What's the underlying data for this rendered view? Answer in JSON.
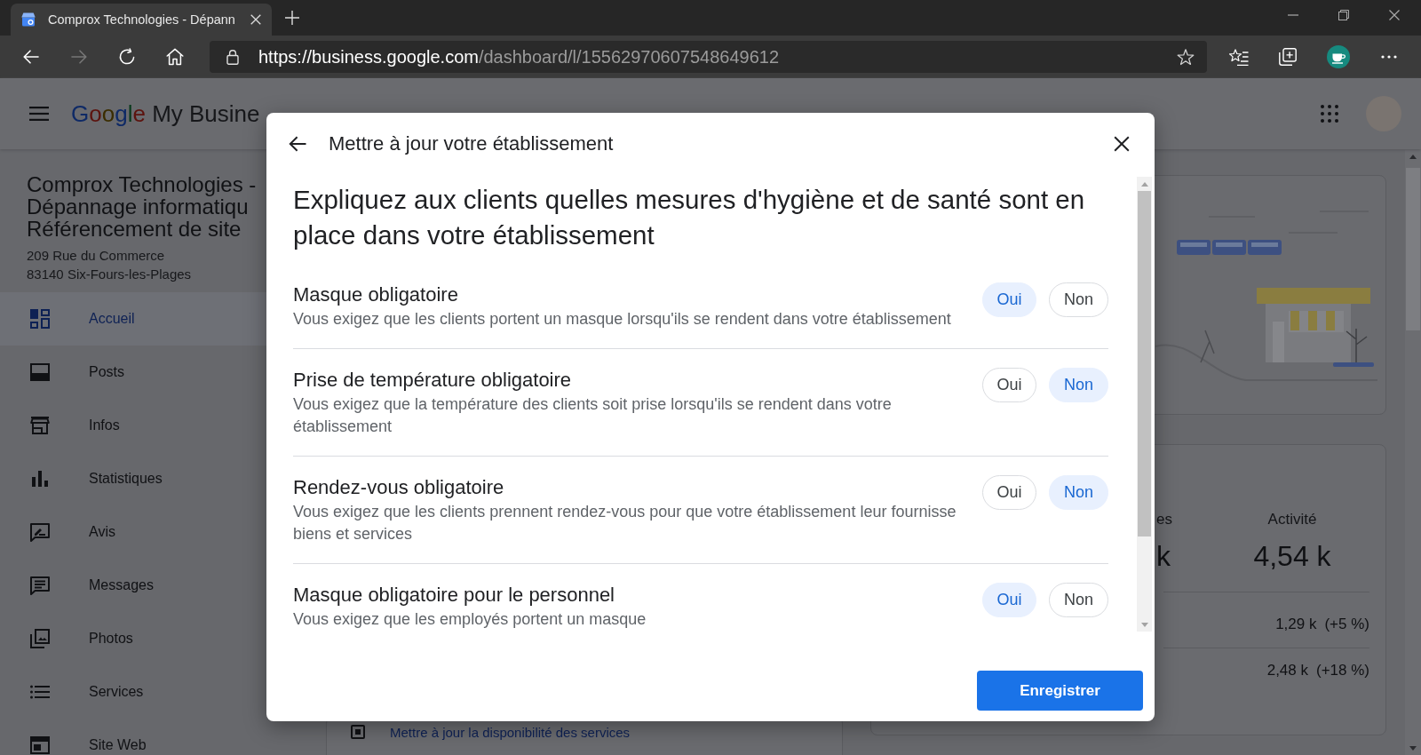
{
  "browser": {
    "tab": {
      "title": "Comprox Technologies - Dépann"
    },
    "nav_buttons": [
      {
        "kind": "back",
        "disabled": false
      },
      {
        "kind": "forward",
        "disabled": true
      },
      {
        "kind": "reload",
        "disabled": false
      },
      {
        "kind": "home",
        "disabled": false
      }
    ],
    "address": {
      "host": "https://business.google.com",
      "path": "/dashboard/l/15562970607548649612"
    }
  },
  "app_header": {
    "logo": {
      "brand": "Google",
      "product": "My Busine"
    }
  },
  "business": {
    "name_lines": [
      "Comprox Technologies -",
      "Dépannage informatiqu",
      "Référencement de site"
    ],
    "address_lines": [
      "209 Rue du Commerce",
      "83140 Six-Fours-les-Plages"
    ]
  },
  "sidebar": {
    "items": [
      {
        "label": "Accueil",
        "selected": true
      },
      {
        "label": "Posts",
        "selected": false
      },
      {
        "label": "Infos",
        "selected": false
      },
      {
        "label": "Statistiques",
        "selected": false
      },
      {
        "label": "Avis",
        "selected": false
      },
      {
        "label": "Messages",
        "selected": false
      },
      {
        "label": "Photos",
        "selected": false
      },
      {
        "label": "Services",
        "selected": false
      },
      {
        "label": "Site Web",
        "selected": false
      }
    ]
  },
  "main": {
    "task_link": "Mettre à jour la disponibilité des services",
    "stats": {
      "columns": [
        {
          "label": "es",
          "value": "k"
        },
        {
          "label": "Activité",
          "value": "4,54 k"
        }
      ],
      "rows": [
        {
          "value": "1,29 k",
          "change": "(+5 %)"
        },
        {
          "value": "2,48 k",
          "change": "(+18 %)"
        }
      ]
    }
  },
  "dialog": {
    "title": "Mettre à jour votre établissement",
    "heading": "Expliquez aux clients quelles mesures d'hygiène et de santé sont en place dans votre établissement",
    "questions": [
      {
        "title": "Masque obligatoire",
        "description": "Vous exigez que les clients portent un masque lorsqu'ils se rendent dans votre établissement",
        "options": [
          {
            "label": "Oui",
            "selected": true
          },
          {
            "label": "Non",
            "selected": false
          }
        ]
      },
      {
        "title": "Prise de température obligatoire",
        "description": "Vous exigez que la température des clients soit prise lorsqu'ils se rendent dans votre établissement",
        "options": [
          {
            "label": "Oui",
            "selected": false
          },
          {
            "label": "Non",
            "selected": true
          }
        ]
      },
      {
        "title": "Rendez-vous obligatoire",
        "description": "Vous exigez que les clients prennent rendez-vous pour que votre établissement leur fournisse biens et services",
        "options": [
          {
            "label": "Oui",
            "selected": false
          },
          {
            "label": "Non",
            "selected": true
          }
        ]
      },
      {
        "title": "Masque obligatoire pour le personnel",
        "description": "Vous exigez que les employés portent un masque",
        "options": [
          {
            "label": "Oui",
            "selected": true
          },
          {
            "label": "Non",
            "selected": false
          }
        ]
      }
    ],
    "save_button": "Enregistrer"
  }
}
